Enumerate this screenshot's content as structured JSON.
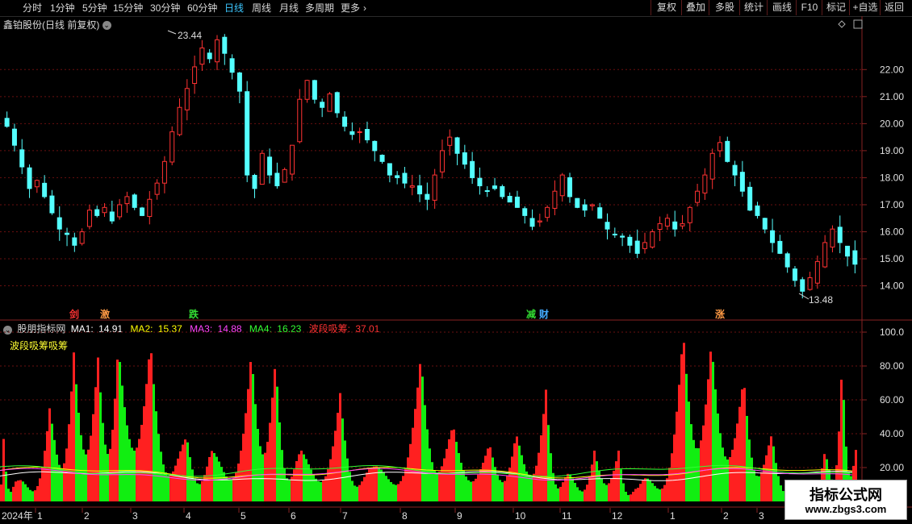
{
  "toolbar": {
    "timeframes": [
      "分时",
      "1分钟",
      "5分钟",
      "15分钟",
      "30分钟",
      "60分钟",
      "日线",
      "周线",
      "月线",
      "多周期",
      "更多"
    ],
    "active": "日线",
    "right_buttons": [
      "复权",
      "叠加",
      "多股",
      "统计",
      "画线",
      "F10",
      "标记",
      "+自选",
      "返回"
    ]
  },
  "main": {
    "title": "鑫铂股份(日线 前复权)",
    "high_label": "23.44",
    "low_label": "13.48",
    "y_ticks": [
      "22.00",
      "21.00",
      "20.00",
      "19.00",
      "18.00",
      "17.00",
      "16.00",
      "15.00",
      "14.00"
    ],
    "signals": [
      {
        "text": "剑",
        "color": "#ff3333"
      },
      {
        "text": "激",
        "color": "#ff9944"
      },
      {
        "text": "跌",
        "color": "#33dd33"
      },
      {
        "text": "减",
        "color": "#33dd33"
      },
      {
        "text": "财",
        "color": "#44aaff"
      },
      {
        "text": "涨",
        "color": "#ff9944"
      }
    ]
  },
  "sub": {
    "name": "股朋指标网",
    "ma1_label": "MA1:",
    "ma1": "14.91",
    "ma2_label": "MA2:",
    "ma2": "15.37",
    "ma3_label": "MA3:",
    "ma3": "14.88",
    "ma4_label": "MA4:",
    "ma4": "16.23",
    "wave_label": "波段吸筹:",
    "wave": "37.01",
    "legend_text": "波段吸筹吸筹",
    "y_ticks": [
      "100.0",
      "80.00",
      "60.00",
      "40.00",
      "20.00"
    ]
  },
  "axis": {
    "year": "2024年",
    "months": [
      "1",
      "2",
      "3",
      "4",
      "5",
      "6",
      "7",
      "8",
      "9",
      "10",
      "11",
      "12",
      "1",
      "2",
      "3"
    ]
  },
  "watermark": {
    "line1": "指标公式网",
    "line2": "www.zbgs3.com"
  },
  "colors": {
    "up": "#ff3232",
    "down": "#54ffff",
    "bar_red": "#ff2020",
    "bar_green": "#11ee11",
    "ma1": "#ffffff",
    "ma2": "#ffff00",
    "ma3": "#ff44ff",
    "ma4": "#33ff33",
    "wave": "#ff3333"
  },
  "chart_data": {
    "type": "candlestick",
    "series_close_approx": [
      19.9,
      19.2,
      18.4,
      17.6,
      17.9,
      17.3,
      16.7,
      16.1,
      15.9,
      15.5,
      16.0,
      16.8,
      16.6,
      16.9,
      16.4,
      17.0,
      17.3,
      16.9,
      16.6,
      17.2,
      17.8,
      18.6,
      19.7,
      20.6,
      21.3,
      22.1,
      22.8,
      22.4,
      23.1,
      22.6,
      21.9,
      21.2,
      18.1,
      17.6,
      18.9,
      18.1,
      17.7,
      18.3,
      19.2,
      20.9,
      21.6,
      20.9,
      20.6,
      21.1,
      20.4,
      19.9,
      19.6,
      19.7,
      19.4,
      19.0,
      18.6,
      18.1,
      18.0,
      17.8,
      17.7,
      17.4,
      17.2,
      18.1,
      19.0,
      19.5,
      18.9,
      18.5,
      18.0,
      17.7,
      17.5,
      17.6,
      17.3,
      17.1,
      16.9,
      16.6,
      16.2,
      16.4,
      16.9,
      17.5,
      18.1,
      17.3,
      16.9,
      16.8,
      17.0,
      16.5,
      16.1,
      15.9,
      15.8,
      15.5,
      15.2,
      15.6,
      16.0,
      16.3,
      16.5,
      16.1,
      16.3,
      16.9,
      17.5,
      18.1,
      18.9,
      19.3,
      18.6,
      18.1,
      17.5,
      16.8,
      16.6,
      16.1,
      15.6,
      15.2,
      14.7,
      14.2,
      13.8,
      14.3,
      14.9,
      15.6,
      16.1,
      15.6,
      15.1,
      14.8
    ],
    "y_range": [
      13.48,
      23.44
    ],
    "sub_indicator": {
      "name": "波段吸筹",
      "ylim": [
        0,
        100
      ],
      "ma1": 14.91,
      "ma2": 15.37,
      "ma3": 14.88,
      "ma4": 16.23,
      "value": 37.01
    }
  }
}
